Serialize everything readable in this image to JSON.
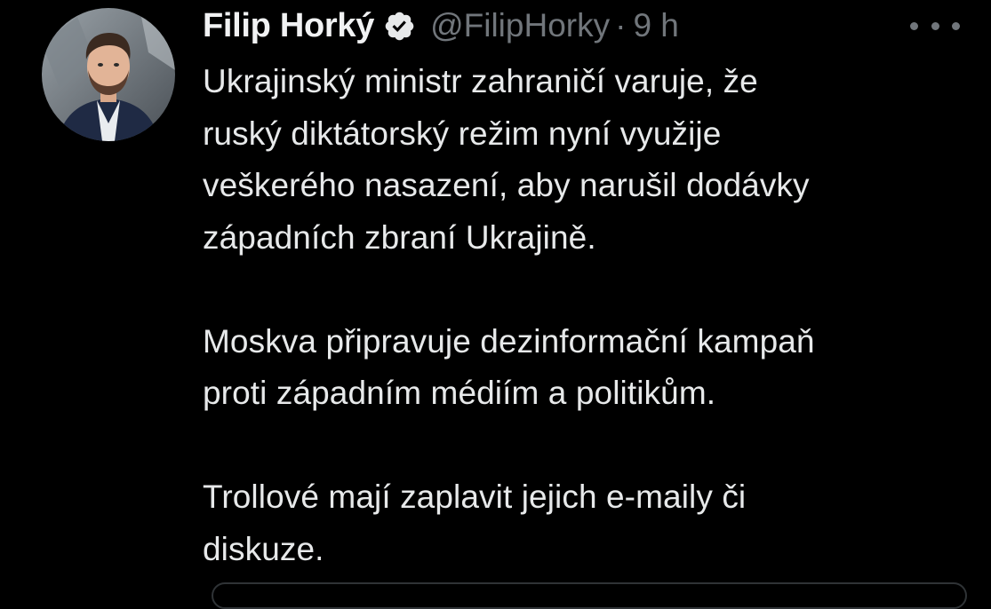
{
  "tweet": {
    "author": {
      "name": "Filip Horký",
      "handle": "@FilipHorky",
      "verified": true,
      "avatar_icon": "user-avatar"
    },
    "separator": "·",
    "timestamp": "9 h",
    "more_icon": "more-horizontal-icon",
    "text": "Ukrajinský ministr zahraničí varuje, že\nruský diktátorský režim nyní využije\nveškerého nasazení, aby narušil dodávky\nzápadních zbraní Ukrajině.\n\nMoskva připravuje dezinformační kampaň\nproti západním médiím a politikům.\n\nTrollové mají zaplavit jejich e-maily či\ndiskuze."
  },
  "colors": {
    "background": "#000000",
    "primary_text": "#e7e9ea",
    "secondary_text": "#71767b",
    "border": "#2f3336"
  }
}
